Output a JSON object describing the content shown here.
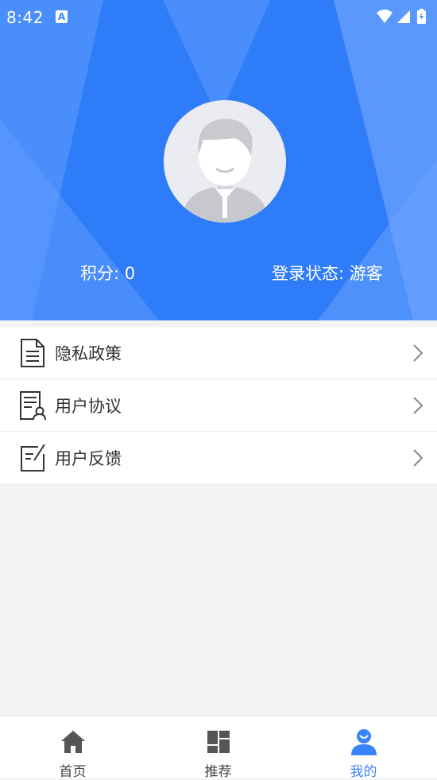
{
  "statusbar": {
    "time": "8:42",
    "notification_badge": "A",
    "icons": [
      "wifi-icon",
      "signal-icon",
      "battery-icon"
    ]
  },
  "profile": {
    "points_label": "积分: 0",
    "login_status_label": "登录状态: 游客"
  },
  "menu": {
    "items": [
      {
        "label": "隐私政策",
        "icon": "document-icon"
      },
      {
        "label": "用户协议",
        "icon": "agreement-icon"
      },
      {
        "label": "用户反馈",
        "icon": "feedback-icon"
      }
    ]
  },
  "tabbar": {
    "tabs": [
      {
        "label": "首页",
        "icon": "home-icon",
        "active": false
      },
      {
        "label": "推荐",
        "icon": "grid-icon",
        "active": false
      },
      {
        "label": "我的",
        "icon": "user-icon",
        "active": true
      }
    ]
  },
  "colors": {
    "accent": "#3b84fb",
    "header_bg": "#3b84fb",
    "background": "#f3f3f3"
  }
}
